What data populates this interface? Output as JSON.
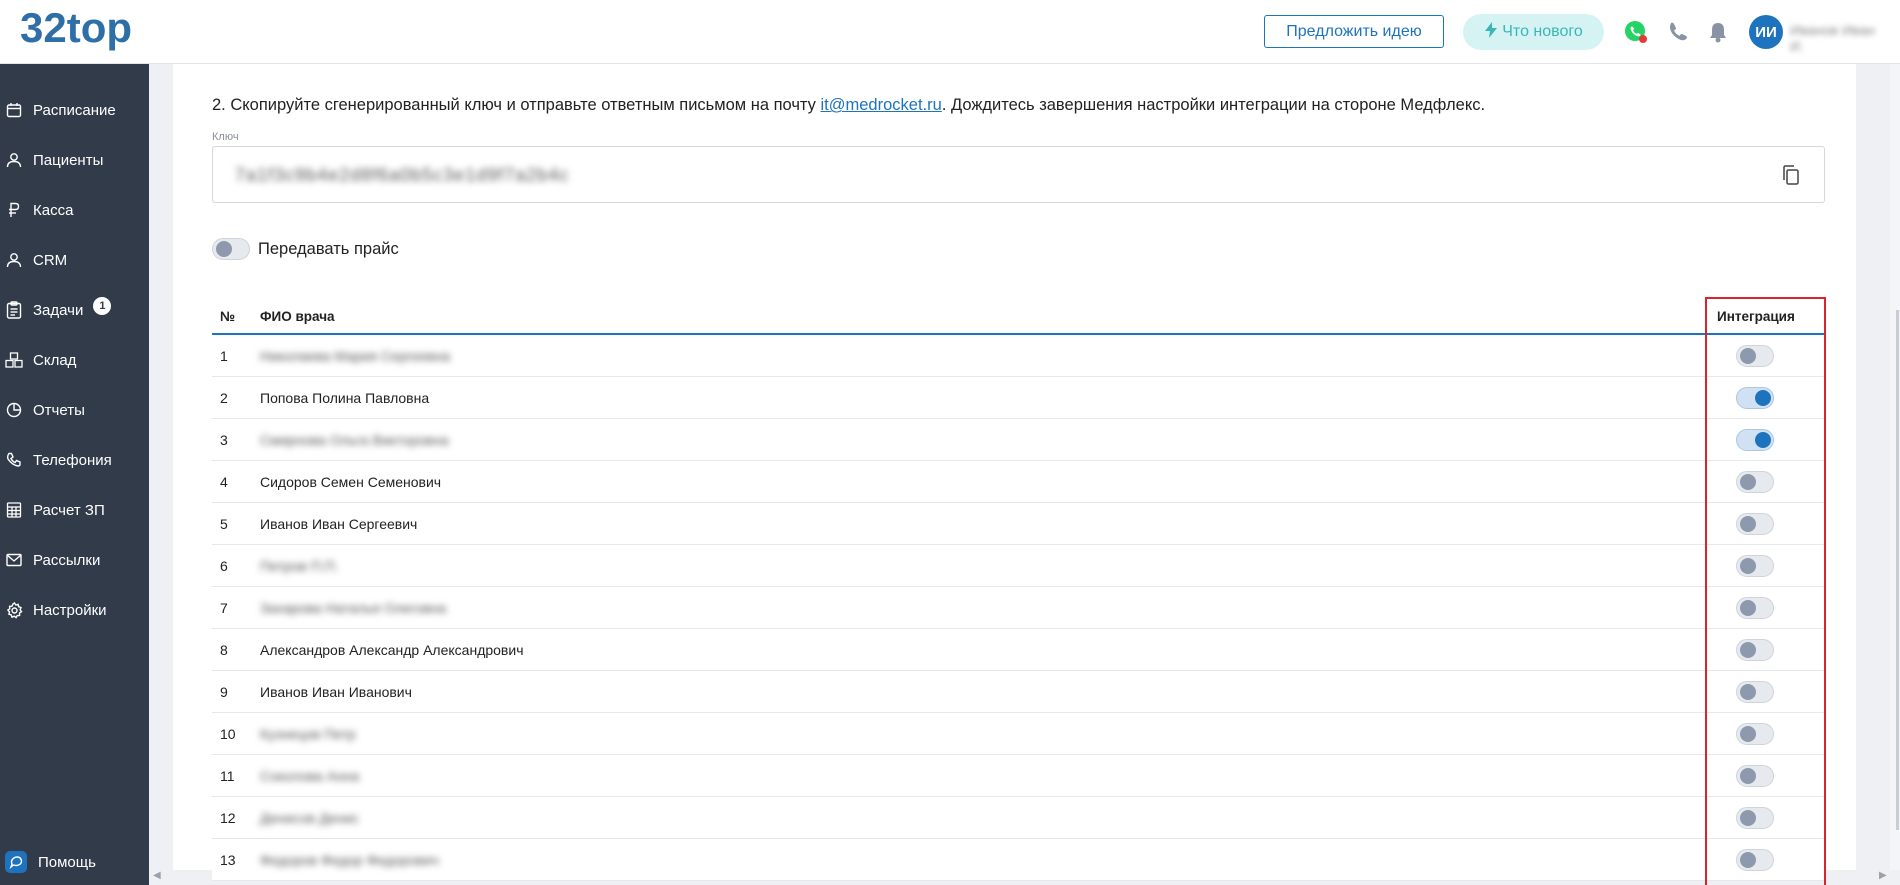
{
  "header": {
    "logo": "32top",
    "suggest_idea": "Предложить идею",
    "whats_new": "Что нового",
    "avatar_initials": "ИИ",
    "username": "Иванов Иван И."
  },
  "sidebar": {
    "items": [
      {
        "label": "Расписание",
        "icon": "calendar-icon"
      },
      {
        "label": "Пациенты",
        "icon": "user-icon"
      },
      {
        "label": "Касса",
        "icon": "ruble-icon"
      },
      {
        "label": "CRM",
        "icon": "user-icon"
      },
      {
        "label": "Задачи",
        "icon": "tasks-icon",
        "badge": "1"
      },
      {
        "label": "Склад",
        "icon": "warehouse-icon"
      },
      {
        "label": "Отчеты",
        "icon": "pie-chart-icon"
      },
      {
        "label": "Телефония",
        "icon": "phone-icon"
      },
      {
        "label": "Расчет ЗП",
        "icon": "calculator-icon"
      },
      {
        "label": "Рассылки",
        "icon": "mail-icon"
      },
      {
        "label": "Настройки",
        "icon": "gear-icon"
      }
    ],
    "help": "Помощь"
  },
  "main": {
    "instruction_prefix": "2. Скопируйте сгенерированный ключ и отправьте ответным письмом на почту ",
    "instruction_email": "it@medrocket.ru",
    "instruction_suffix": ". Дождитесь завершения настройки интеграции на стороне Медфлекс.",
    "key_label": "Ключ",
    "key_value": "7a1f3c9b4e2d8f6a0b5c3e1d9f7a2b4c",
    "price_toggle_label": "Передавать прайс",
    "price_toggle_on": false,
    "table": {
      "headers": {
        "num": "№",
        "name": "ФИО врача",
        "integration": "Интеграция"
      },
      "rows": [
        {
          "num": "1",
          "name": "Николаева Мария Сергеевна",
          "blurred": true,
          "on": false
        },
        {
          "num": "2",
          "name": "Попова Полина Павловна",
          "blurred": false,
          "on": true
        },
        {
          "num": "3",
          "name": "Смирнова Ольга Викторовна",
          "blurred": true,
          "on": true
        },
        {
          "num": "4",
          "name": "Сидоров Семен Семенович",
          "blurred": false,
          "on": false
        },
        {
          "num": "5",
          "name": "Иванов Иван Сергеевич",
          "blurred": false,
          "on": false
        },
        {
          "num": "6",
          "name": "Петров П.П.",
          "blurred": true,
          "on": false
        },
        {
          "num": "7",
          "name": "Захарова Наталья Олеговна",
          "blurred": true,
          "on": false
        },
        {
          "num": "8",
          "name": "Александров Александр Александрович",
          "blurred": false,
          "on": false
        },
        {
          "num": "9",
          "name": "Иванов Иван Иванович",
          "blurred": false,
          "on": false
        },
        {
          "num": "10",
          "name": "Кузнецов Петр",
          "blurred": true,
          "on": false
        },
        {
          "num": "11",
          "name": "Соколова Анна",
          "blurred": true,
          "on": false
        },
        {
          "num": "12",
          "name": "Денисов Денис",
          "blurred": true,
          "on": false
        },
        {
          "num": "13",
          "name": "Федоров Федор Федорович",
          "blurred": true,
          "on": false
        }
      ]
    }
  },
  "colors": {
    "sidebar_bg": "#313b49",
    "accent": "#1e73be",
    "highlight_border": "#d9232d",
    "whats_new_bg": "#d5f3f3"
  }
}
